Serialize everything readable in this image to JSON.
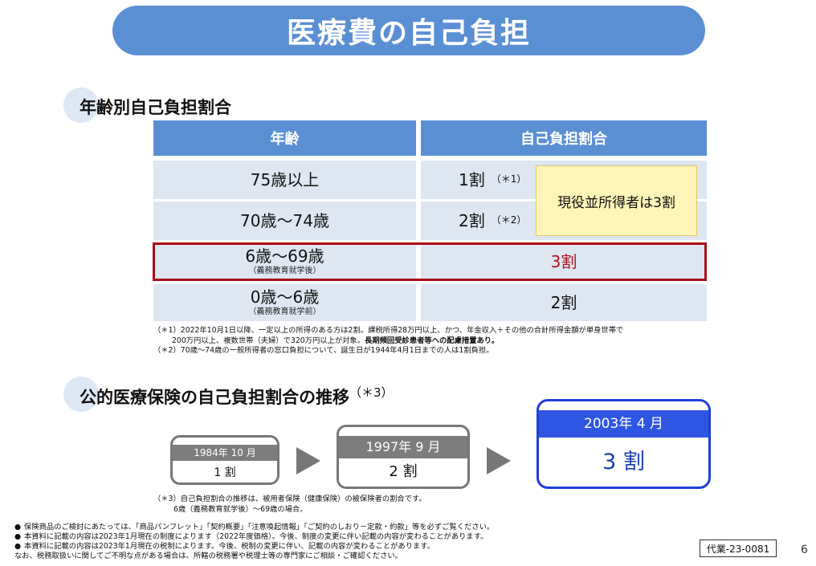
{
  "title": "医療費の自己負担",
  "section1": {
    "heading": "年齢別自己負担割合"
  },
  "table": {
    "headers": {
      "age": "年齢",
      "ratio": "自己負担割合"
    },
    "rows": [
      {
        "age": "75歳以上",
        "age_sub": "",
        "ratio": "1割",
        "note": "（＊1）"
      },
      {
        "age": "70歳～74歳",
        "age_sub": "",
        "ratio": "2割",
        "note": "（＊2）"
      },
      {
        "age": "6歳～69歳",
        "age_sub": "（義務教育就学後）",
        "ratio": "3割",
        "note": ""
      },
      {
        "age": "0歳～6歳",
        "age_sub": "（義務教育就学前）",
        "ratio": "2割",
        "note": ""
      }
    ],
    "callout": "現役並所得者は3割"
  },
  "footnotes": {
    "n1_line1": "（＊1）2022年10月1日以降、一定以上の所得のある方は2割。課税所得28万円以上、かつ、年金収入＋その他の合計所得金額が単身世帯で",
    "n1_line2_a": "200万円以上、複数世帯（夫婦）で320万円以上が対象。",
    "n1_line2_b": "長期頻回受診患者等への配慮措置あり。",
    "n2": "（＊2）70歳～74歳の一般所得者の窓口負担について、誕生日が1944年4月1日までの人は1割負担。"
  },
  "section2": {
    "heading": "公的医療保険の自己負担割合の推移",
    "heading_mark": "（＊3）"
  },
  "history": [
    {
      "date": "1984年 10 月",
      "ratio": "1 割"
    },
    {
      "date": "1997年 9 月",
      "ratio": "2 割"
    },
    {
      "date": "2003年 4 月",
      "ratio": "3 割"
    }
  ],
  "footnote3": {
    "line1": "（＊3）自己負担割合の推移は、被用者保険（健康保険）の被保険者の割合です。",
    "line2": "6歳（義務教育就学後）～69歳の場合。"
  },
  "bottom_notes": {
    "b1": "保険商品のご検討にあたっては、「商品パンフレット」「契約概要」「注意喚起情報」「ご契約のしおり－定款・約款」等を必ずご覧ください。",
    "b2": "本資料に記載の内容は2023年1月現在の制度によります（2022年度価格）。今後、制度の変更に伴い記載の内容が変わることがあります。",
    "b3": "本資料に記載の内容は2023年1月現在の税制によります。今後、税制の変更に伴い、記載の内容が変わることがあります。",
    "line4": "なお、税務取扱いに関してご不明な点がある場合は、所轄の税務署や税理士等の専門家にご相談・ご確認ください。",
    "bullet": "●"
  },
  "doc_code": "代業-23-0081",
  "page_number": "6"
}
